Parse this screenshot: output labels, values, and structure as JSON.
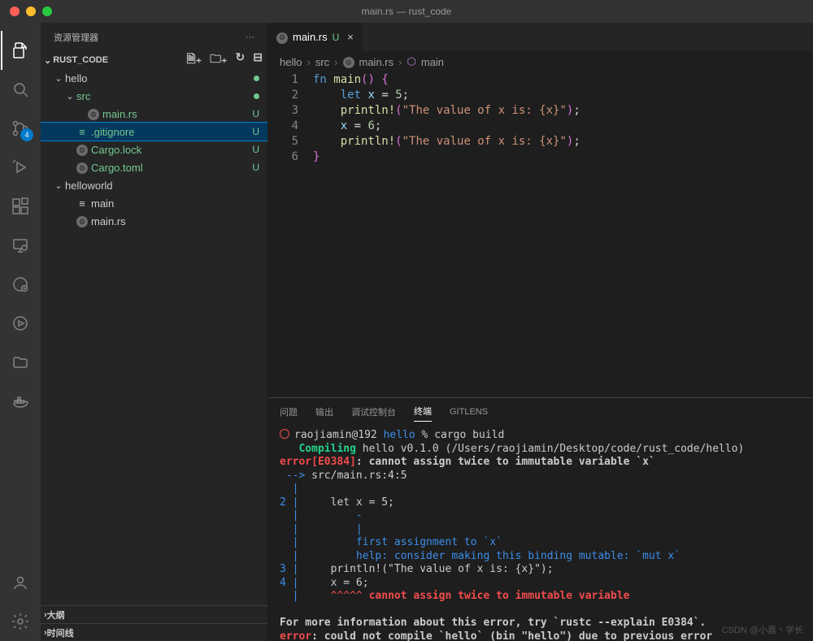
{
  "window": {
    "title": "main.rs — rust_code"
  },
  "sidebar": {
    "title": "资源管理器",
    "root": "RUST_CODE",
    "collapsed_sections": [
      "大纲",
      "时间线"
    ],
    "tree": {
      "hello": {
        "label": "hello",
        "src": {
          "label": "src",
          "main_rs": {
            "label": "main.rs",
            "status": "U"
          }
        },
        "gitignore": {
          "label": ".gitignore",
          "status": "U"
        },
        "cargo_lock": {
          "label": "Cargo.lock",
          "status": "U"
        },
        "cargo_toml": {
          "label": "Cargo.toml",
          "status": "U"
        }
      },
      "helloworld": {
        "label": "helloworld",
        "main": {
          "label": "main"
        },
        "main_rs": {
          "label": "main.rs"
        }
      }
    }
  },
  "activity": {
    "scm_badge": "4"
  },
  "tabs": [
    {
      "label": "main.rs",
      "status": "U"
    }
  ],
  "breadcrumb": {
    "parts": [
      "hello",
      "src",
      "main.rs",
      "main"
    ]
  },
  "code": {
    "lines": [
      "1",
      "2",
      "3",
      "4",
      "5",
      "6"
    ],
    "tokens": {
      "fn": "fn",
      "main": "main",
      "paren": "()",
      "ob": "{",
      "let": "let",
      "x": "x",
      "eq": "=",
      "five": "5",
      "semi": ";",
      "println": "println!",
      "op": "(",
      "str": "\"The value of x is: {x}\"",
      "cp": ")",
      "six": "6",
      "cb": "}"
    }
  },
  "panel": {
    "tabs": {
      "problems": "问题",
      "output": "输出",
      "debug": "调试控制台",
      "terminal": "终端",
      "gitlens": "GITLENS"
    }
  },
  "terminal": {
    "prompt_user": "raojiamin@192",
    "prompt_dir": "hello",
    "prompt_sym": "%",
    "cmd": "cargo build",
    "compiling": "Compiling",
    "compile_pkg": "hello v0.1.0 (/Users/raojiamin/Desktop/code/rust_code/hello)",
    "err_code": "error[E0384]",
    "err_msg": ": cannot assign twice to immutable variable `x`",
    "arrow": " -->",
    "loc": "src/main.rs:4:5",
    "pipe": "|",
    "ln2": "2",
    "code2": "    let x = 5;",
    "under2": "        -",
    "under2b": "        |",
    "hint1": "        first assignment to `x`",
    "hint2": "        help: consider making this binding mutable: `mut x`",
    "ln3": "3",
    "code3": "    println!(\"The value of x is: {x}\");",
    "ln4": "4",
    "code4": "    x = 6;",
    "carets": "    ^^^^^",
    "caret_msg": " cannot assign twice to immutable variable",
    "info1": "For more information about this error, try `rustc --explain E0384`.",
    "err2_label": "error",
    "err2_msg": ": could not compile `hello` (bin \"hello\") due to previous error"
  },
  "watermark": "CSDN @小嘉丶学长"
}
